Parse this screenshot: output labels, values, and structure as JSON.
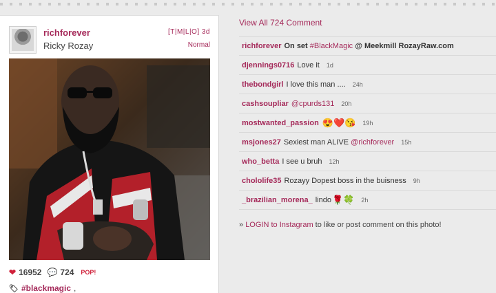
{
  "post": {
    "username": "richforever",
    "full_name": "Ricky Rozay",
    "links": "[T|M|L|O] 3d",
    "filter": "Normal",
    "photo_icon": "photo-of-man-in-sunglasses-icon",
    "likes": "16952",
    "comments_count": "724",
    "pop_label": "POP!",
    "tag": "#blackmagic",
    "tag_suffix": ","
  },
  "comments_panel": {
    "view_all": "View All 724 Comment",
    "items": [
      {
        "user": "richforever",
        "parts": [
          {
            "t": "On set ",
            "s": "bold"
          },
          {
            "t": "#BlackMagic",
            "s": "mention"
          },
          {
            "t": " @ Meekmill RozayRaw.com",
            "s": "bold"
          }
        ],
        "time": ""
      },
      {
        "user": "djennings0716",
        "parts": [
          {
            "t": "Love it",
            "s": "text"
          }
        ],
        "time": "1d"
      },
      {
        "user": "thebondgirl",
        "parts": [
          {
            "t": "I love this man ....",
            "s": "text"
          }
        ],
        "time": "24h"
      },
      {
        "user": "cashsoupliar",
        "parts": [
          {
            "t": "@cpurds131",
            "s": "mention"
          }
        ],
        "time": "20h"
      },
      {
        "user": "mostwanted_passion",
        "parts": [
          {
            "t": "😍❤️😘",
            "s": "emoji"
          }
        ],
        "time": "19h"
      },
      {
        "user": "msjones27",
        "parts": [
          {
            "t": "Sexiest man ALIVE ",
            "s": "text"
          },
          {
            "t": "@richforever",
            "s": "mention"
          }
        ],
        "time": "15h"
      },
      {
        "user": "who_betta",
        "parts": [
          {
            "t": "I see u bruh",
            "s": "text"
          }
        ],
        "time": "12h"
      },
      {
        "user": "chololife35",
        "parts": [
          {
            "t": "Rozayy Dopest boss in the buisness",
            "s": "text"
          }
        ],
        "time": "9h"
      },
      {
        "user": "_brazilian_morena_",
        "parts": [
          {
            "t": "lindo",
            "s": "text"
          },
          {
            "t": "🌹🍀",
            "s": "emoji"
          }
        ],
        "time": "2h"
      }
    ],
    "login_prefix": "» ",
    "login_link": "LOGIN to Instagram",
    "login_suffix": " to like or post comment on this photo!"
  },
  "colors": {
    "accent": "#a52a5a",
    "heart": "#d0203a",
    "comment_icon": "#20a0c8",
    "background": "#ebebeb"
  }
}
